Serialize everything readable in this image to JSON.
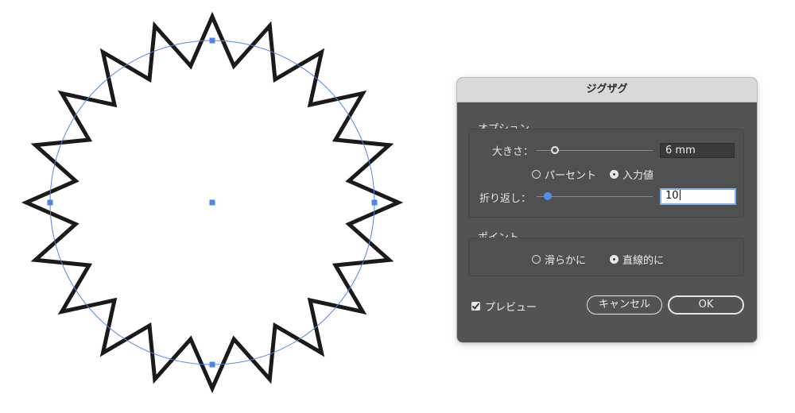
{
  "artwork": {
    "zigzag_stroke_color": "#1a1a1a",
    "path_outline_color": "#4f86e6",
    "anchor_color": "#4f86e6",
    "zigzag_ridges": 20
  },
  "dialog": {
    "title": "ジグザグ",
    "options": {
      "group_label": "オプション",
      "size_label": "大きさ：",
      "size_value": "6 mm",
      "size_mode_percent": "パーセント",
      "size_mode_absolute": "入力値",
      "size_mode_selected": "入力値",
      "ridges_label": "折り返し：",
      "ridges_value": "10"
    },
    "points": {
      "group_label": "ポイント",
      "smooth": "滑らかに",
      "corner": "直線的に",
      "selected": "直線的に"
    },
    "preview_label": "プレビュー",
    "preview_checked": true,
    "cancel_label": "キャンセル",
    "ok_label": "OK"
  }
}
